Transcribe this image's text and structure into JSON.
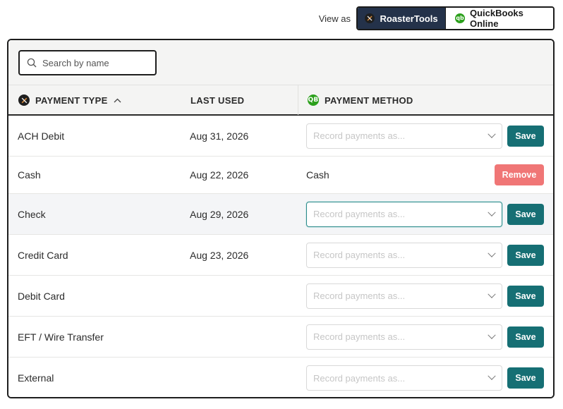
{
  "view_as": {
    "label": "View as",
    "options": [
      {
        "label": "RoasterTools",
        "active": true
      },
      {
        "label": "QuickBooks Online",
        "active": false
      }
    ]
  },
  "search": {
    "placeholder": "Search by name",
    "value": ""
  },
  "table": {
    "headers": {
      "payment_type": "PAYMENT TYPE",
      "last_used": "LAST USED",
      "payment_method": "PAYMENT METHOD"
    },
    "sort": {
      "column": "payment_type",
      "direction": "ascending"
    },
    "rows": [
      {
        "type": "ACH Debit",
        "last_used": "Aug 31, 2026",
        "method": "",
        "placeholder": "Record payments as...",
        "action": "Save"
      },
      {
        "type": "Cash",
        "last_used": "Aug 22, 2026",
        "method": "Cash",
        "placeholder": "",
        "action": "Remove"
      },
      {
        "type": "Check",
        "last_used": "Aug 29, 2026",
        "method": "",
        "placeholder": "Record payments as...",
        "action": "Save"
      },
      {
        "type": "Credit Card",
        "last_used": "Aug 23, 2026",
        "method": "",
        "placeholder": "Record payments as...",
        "action": "Save"
      },
      {
        "type": "Debit Card",
        "last_used": "",
        "method": "",
        "placeholder": "Record payments as...",
        "action": "Save"
      },
      {
        "type": "EFT / Wire Transfer",
        "last_used": "",
        "method": "",
        "placeholder": "Record payments as...",
        "action": "Save"
      },
      {
        "type": "External",
        "last_used": "",
        "method": "",
        "placeholder": "Record payments as...",
        "action": "Save"
      }
    ]
  },
  "colors": {
    "active_toggle": "#24324a",
    "save_button": "#166f74",
    "remove_button": "#f07676",
    "quickbooks_green": "#2ca01c"
  },
  "icons": {
    "roastertools": "roastertools-logo-icon",
    "quickbooks": "quickbooks-logo-icon",
    "search": "search-icon",
    "sort": "sort-ascending-icon",
    "dropdown": "chevron-down-icon"
  }
}
